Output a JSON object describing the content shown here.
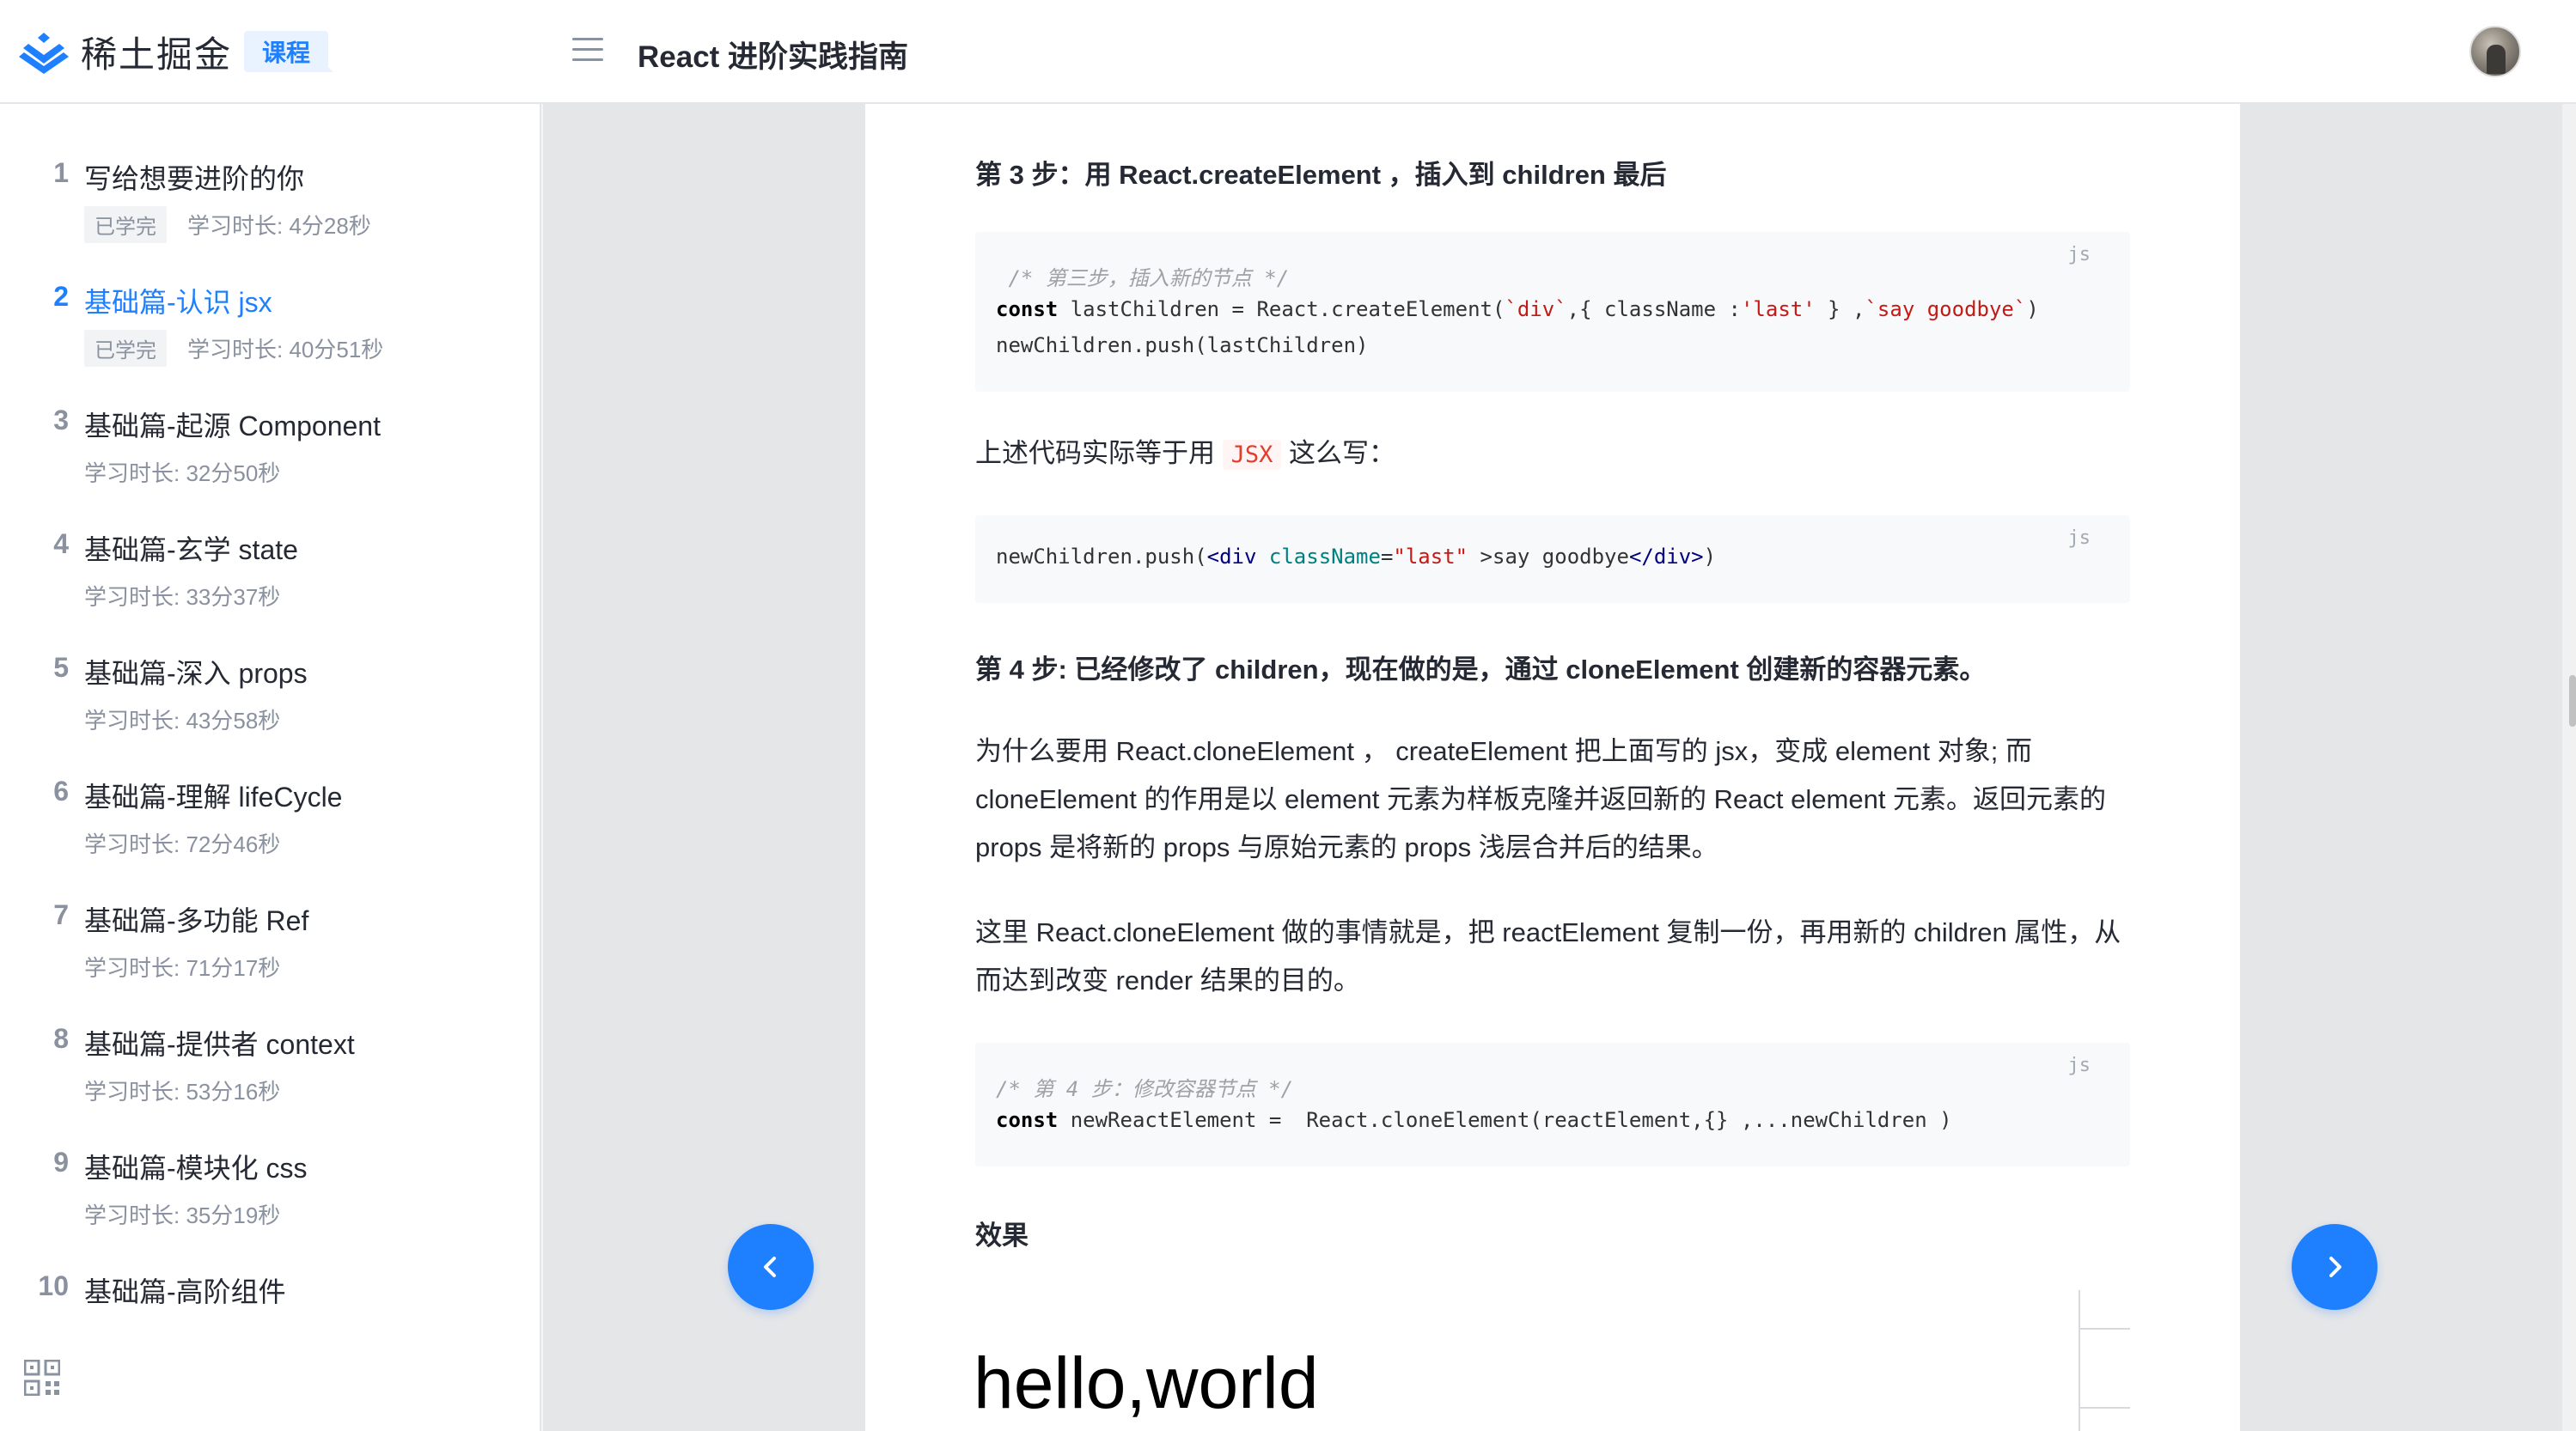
{
  "header": {
    "logo_text": "稀土掘金",
    "course_badge": "课程",
    "book_title": "React 进阶实践指南"
  },
  "sidebar": {
    "chapters": [
      {
        "num": "1",
        "title": "写给想要进阶的你",
        "done": "已学完",
        "duration": "学习时长: 4分28秒"
      },
      {
        "num": "2",
        "title": "基础篇-认识 jsx",
        "done": "已学完",
        "duration": "学习时长: 40分51秒"
      },
      {
        "num": "3",
        "title": "基础篇-起源 Component",
        "duration": "学习时长: 32分50秒"
      },
      {
        "num": "4",
        "title": "基础篇-玄学 state",
        "duration": "学习时长: 33分37秒"
      },
      {
        "num": "5",
        "title": "基础篇-深入 props",
        "duration": "学习时长: 43分58秒"
      },
      {
        "num": "6",
        "title": "基础篇-理解 lifeCycle",
        "duration": "学习时长: 72分46秒"
      },
      {
        "num": "7",
        "title": "基础篇-多功能 Ref",
        "duration": "学习时长: 71分17秒"
      },
      {
        "num": "8",
        "title": "基础篇-提供者 context",
        "duration": "学习时长: 53分16秒"
      },
      {
        "num": "9",
        "title": "基础篇-模块化 css",
        "duration": "学习时长: 35分19秒"
      },
      {
        "num": "10",
        "title": "基础篇-高阶组件"
      }
    ],
    "active_chapter": "2"
  },
  "article": {
    "step3_heading": "第 3 步：用 React.createElement ，插入到 children 最后",
    "code1": {
      "lang": "js",
      "line1": " /* 第三步，插入新的节点 */",
      "line2_kw": "const",
      "line2_a": " lastChildren = React.createElement(",
      "line2_s1": "`div`",
      "line2_b": ",{ className :",
      "line2_s2": "'last'",
      "line2_c": " } ,",
      "line2_s3": "`say goodbye`",
      "line2_d": ")",
      "line3": "newChildren.push(lastChildren)"
    },
    "jsx_para_before": "上述代码实际等于用",
    "jsx_inline": "JSX",
    "jsx_para_after": "这么写：",
    "code2": {
      "lang": "js",
      "a": "newChildren.push(",
      "tag_open": "<div",
      "attr": "className",
      "eq": "=",
      "str": "\"last\"",
      "b": " >say goodbye",
      "tag_close": "</div>",
      "c": ")"
    },
    "step4_heading": "第 4 步: 已经修改了 children，现在做的是，通过 cloneElement 创建新的容器元素。",
    "para1": "为什么要用 React.cloneElement ， createElement 把上面写的 jsx，变成 element 对象; 而 cloneElement 的作用是以 element 元素为样板克隆并返回新的 React element 元素。返回元素的 props 是将新的 props 与原始元素的 props 浅层合并后的结果。",
    "para2": "这里 React.cloneElement 做的事情就是，把 reactElement 复制一份，再用新的 children 属性，从而达到改变 render 结果的目的。",
    "code3": {
      "lang": "js",
      "line1": "/* 第 4 步：修改容器节点 */",
      "line2_kw": "const",
      "line2_rest": " newReactElement =  React.cloneElement(reactElement,{} ,...newChildren )"
    },
    "effect_heading": "效果",
    "result_text": "hello,world"
  },
  "nav": {
    "prev_icon": "chevron-left-icon",
    "next_icon": "chevron-right-icon"
  },
  "colors": {
    "accent": "#1e80ff",
    "text": "#252933",
    "muted": "#8a919f"
  }
}
